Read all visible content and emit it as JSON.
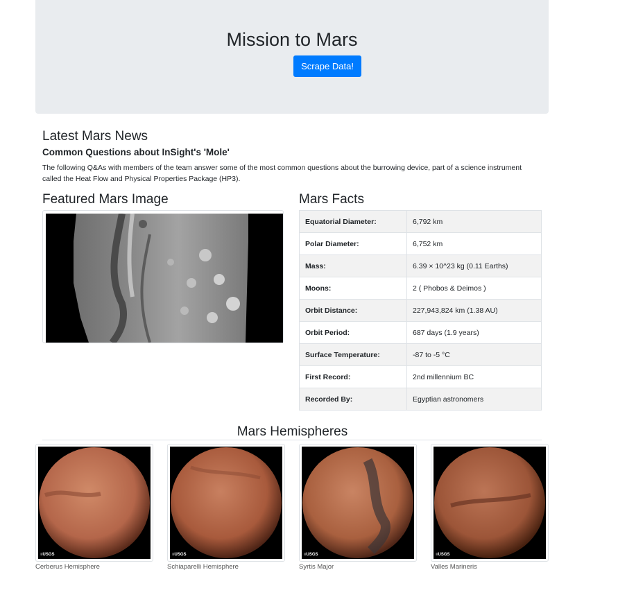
{
  "header": {
    "title": "Mission to Mars",
    "scrape_label": "Scrape Data!"
  },
  "news": {
    "heading": "Latest Mars News",
    "title": "Common Questions about InSight's 'Mole'",
    "paragraph": "The following Q&As with members of the team answer some of the most common questions about the burrowing device, part of a science instrument called the Heat Flow and Physical Properties Package (HP3)."
  },
  "featured": {
    "heading": "Featured Mars Image"
  },
  "facts": {
    "heading": "Mars Facts",
    "rows": [
      {
        "label": "Equatorial Diameter:",
        "value": "6,792 km"
      },
      {
        "label": "Polar Diameter:",
        "value": "6,752 km"
      },
      {
        "label": "Mass:",
        "value": "6.39 × 10^23 kg (0.11 Earths)"
      },
      {
        "label": "Moons:",
        "value": "2 ( Phobos & Deimos )"
      },
      {
        "label": "Orbit Distance:",
        "value": "227,943,824 km (1.38 AU)"
      },
      {
        "label": "Orbit Period:",
        "value": "687 days (1.9 years)"
      },
      {
        "label": "Surface Temperature:",
        "value": "-87 to -5 °C"
      },
      {
        "label": "First Record:",
        "value": "2nd millennium BC"
      },
      {
        "label": "Recorded By:",
        "value": "Egyptian astronomers"
      }
    ]
  },
  "hemispheres": {
    "heading": "Mars Hemispheres",
    "items": [
      {
        "caption": "Cerberus Hemisphere",
        "color": "#b4664a"
      },
      {
        "caption": "Schiaparelli Hemisphere",
        "color": "#a85a3c"
      },
      {
        "caption": "Syrtis Major",
        "color": "#a9603f"
      },
      {
        "caption": "Valles Marineris",
        "color": "#9c5538"
      }
    ]
  },
  "colors": {
    "accent": "#007bff",
    "jumbotron": "#e9ecef"
  }
}
